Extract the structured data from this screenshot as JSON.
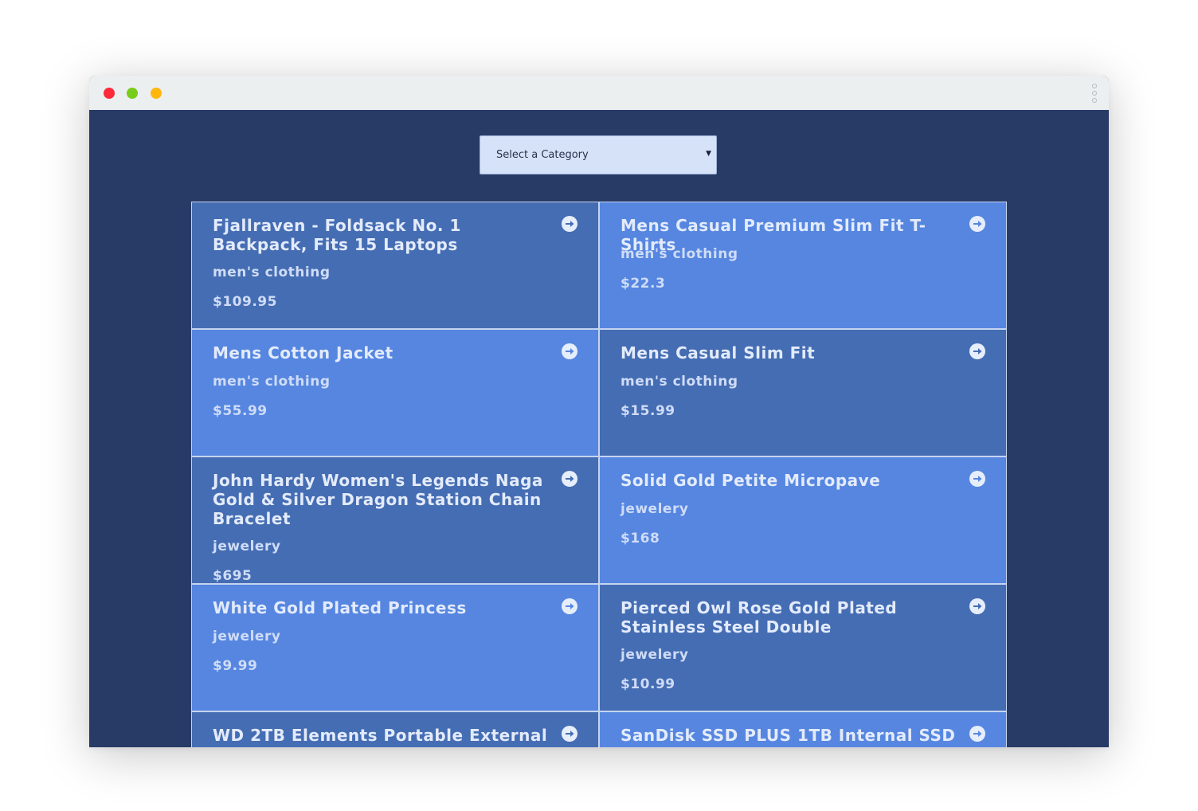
{
  "window": {
    "controls": [
      "close",
      "minimize",
      "zoom"
    ],
    "menu_icon": "kebab-menu-icon"
  },
  "filter": {
    "selected_label": "Select a Category",
    "caret_icon": "chevron-down-icon"
  },
  "colors": {
    "page_background": "#283b67",
    "card_dark": "#456db3",
    "card_light": "#5686e0",
    "text": "#e3ebfb",
    "select_background": "#d6e2f8"
  },
  "products": [
    {
      "title": "Fjallraven - Foldsack No. 1 Backpack, Fits 15 Laptops",
      "category": "men's clothing",
      "price": "$109.95"
    },
    {
      "title": "Mens Casual Premium Slim Fit T-Shirts",
      "category": "men's clothing",
      "price": "$22.3"
    },
    {
      "title": "Mens Cotton Jacket",
      "category": "men's clothing",
      "price": "$55.99"
    },
    {
      "title": "Mens Casual Slim Fit",
      "category": "men's clothing",
      "price": "$15.99"
    },
    {
      "title": "John Hardy Women's Legends Naga Gold & Silver Dragon Station Chain Bracelet",
      "category": "jewelery",
      "price": "$695"
    },
    {
      "title": "Solid Gold Petite Micropave",
      "category": "jewelery",
      "price": "$168"
    },
    {
      "title": "White Gold Plated Princess",
      "category": "jewelery",
      "price": "$9.99"
    },
    {
      "title": "Pierced Owl Rose Gold Plated Stainless Steel Double",
      "category": "jewelery",
      "price": "$10.99"
    },
    {
      "title": "WD 2TB Elements Portable External",
      "category": "",
      "price": ""
    },
    {
      "title": "SanDisk SSD PLUS 1TB Internal SSD -",
      "category": "",
      "price": ""
    }
  ],
  "card_action_icon": "arrow-right-circle-icon"
}
